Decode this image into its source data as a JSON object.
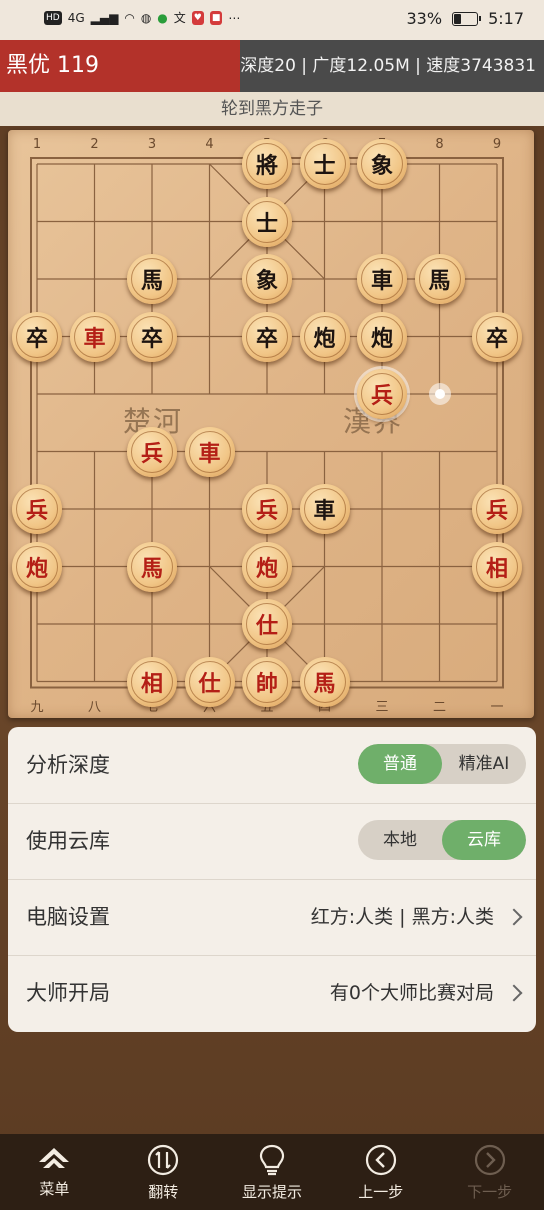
{
  "status_bar": {
    "icons_left": [
      "HD",
      "4G",
      "signal-icon",
      "wifi-icon",
      "wechat-icon",
      "battery-saver-icon",
      "translate-icon",
      "app-icon-1",
      "app-icon-2",
      "more-icon"
    ],
    "battery_percent": "33%",
    "battery_level": 0.33,
    "time": "5:17"
  },
  "info": {
    "eval": "黑优 119",
    "stats": "深度20 | 广度12.05M | 速度3743831"
  },
  "turn_text": "轮到黑方走子",
  "board": {
    "files_top": [
      "1",
      "2",
      "3",
      "4",
      "5",
      "6",
      "7",
      "8",
      "9"
    ],
    "files_bottom": [
      "九",
      "八",
      "七",
      "六",
      "五",
      "四",
      "三",
      "二",
      "一"
    ],
    "river_left": "楚河",
    "river_right": "漢界",
    "pieces": [
      {
        "side": "black",
        "char": "將",
        "col": 4,
        "row": 0
      },
      {
        "side": "black",
        "char": "士",
        "col": 5,
        "row": 0
      },
      {
        "side": "black",
        "char": "象",
        "col": 6,
        "row": 0
      },
      {
        "side": "black",
        "char": "士",
        "col": 4,
        "row": 1
      },
      {
        "side": "black",
        "char": "馬",
        "col": 2,
        "row": 2
      },
      {
        "side": "black",
        "char": "象",
        "col": 4,
        "row": 2
      },
      {
        "side": "black",
        "char": "車",
        "col": 6,
        "row": 2
      },
      {
        "side": "black",
        "char": "馬",
        "col": 7,
        "row": 2
      },
      {
        "side": "black",
        "char": "卒",
        "col": 0,
        "row": 3
      },
      {
        "side": "red",
        "char": "車",
        "col": 1,
        "row": 3
      },
      {
        "side": "black",
        "char": "卒",
        "col": 2,
        "row": 3
      },
      {
        "side": "black",
        "char": "卒",
        "col": 4,
        "row": 3
      },
      {
        "side": "black",
        "char": "炮",
        "col": 5,
        "row": 3
      },
      {
        "side": "black",
        "char": "炮",
        "col": 6,
        "row": 3
      },
      {
        "side": "black",
        "char": "卒",
        "col": 8,
        "row": 3
      },
      {
        "side": "red",
        "char": "兵",
        "col": 6,
        "row": 4,
        "selected": true
      },
      {
        "side": "red",
        "char": "兵",
        "col": 2,
        "row": 5
      },
      {
        "side": "red",
        "char": "車",
        "col": 3,
        "row": 5
      },
      {
        "side": "red",
        "char": "兵",
        "col": 0,
        "row": 6
      },
      {
        "side": "red",
        "char": "兵",
        "col": 4,
        "row": 6
      },
      {
        "side": "black",
        "char": "車",
        "col": 5,
        "row": 6
      },
      {
        "side": "red",
        "char": "兵",
        "col": 8,
        "row": 6
      },
      {
        "side": "red",
        "char": "炮",
        "col": 0,
        "row": 7
      },
      {
        "side": "red",
        "char": "馬",
        "col": 2,
        "row": 7
      },
      {
        "side": "red",
        "char": "炮",
        "col": 4,
        "row": 7
      },
      {
        "side": "red",
        "char": "相",
        "col": 8,
        "row": 7
      },
      {
        "side": "red",
        "char": "仕",
        "col": 4,
        "row": 8
      },
      {
        "side": "red",
        "char": "相",
        "col": 2,
        "row": 9
      },
      {
        "side": "red",
        "char": "仕",
        "col": 3,
        "row": 9
      },
      {
        "side": "red",
        "char": "帥",
        "col": 4,
        "row": 9
      },
      {
        "side": "red",
        "char": "馬",
        "col": 5,
        "row": 9
      }
    ],
    "move_marker": {
      "col": 7,
      "row": 4
    }
  },
  "settings": {
    "depth": {
      "label": "分析深度",
      "options": [
        "普通",
        "精准AI"
      ],
      "selected": 0
    },
    "cloud": {
      "label": "使用云库",
      "options": [
        "本地",
        "云库"
      ],
      "selected": 1
    },
    "computer": {
      "label": "电脑设置",
      "value": "红方:人类 | 黑方:人类"
    },
    "master": {
      "label": "大师开局",
      "value": "有0个大师比赛对局"
    }
  },
  "nav": {
    "menu": "菜单",
    "flip": "翻转",
    "hint": "显示提示",
    "prev": "上一步",
    "next": "下一步"
  }
}
